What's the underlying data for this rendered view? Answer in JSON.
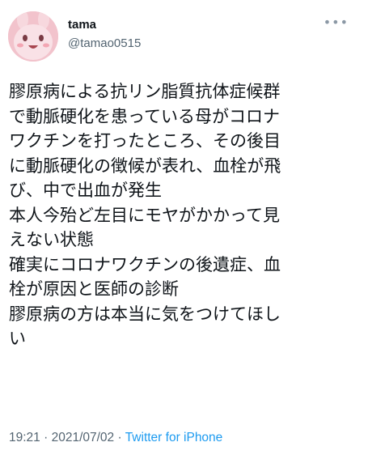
{
  "author": {
    "display_name": "tama",
    "handle": "@tamao0515"
  },
  "menu_icon": "more-horizontal-icon",
  "tweet_lines": [
    "膠原病による抗リン脂質抗体症候群",
    "で動脈硬化を患っている母がコロナ",
    "ワクチンを打ったところ、その後目",
    "に動脈硬化の徴候が表れ、血栓が飛",
    "び、中で出血が発生",
    "本人今殆ど左目にモヤがかかって見",
    "えない状態",
    "確実にコロナワクチンの後遺症、血",
    "栓が原因と医師の診断",
    "膠原病の方は本当に気をつけてほし",
    "い"
  ],
  "meta": {
    "time": "19:21",
    "separator": "·",
    "date": "2021/07/02",
    "source": "Twitter for iPhone"
  },
  "colors": {
    "avatar_bg": "#f4c6cf",
    "link": "#1d9bf0",
    "muted": "#536471"
  }
}
